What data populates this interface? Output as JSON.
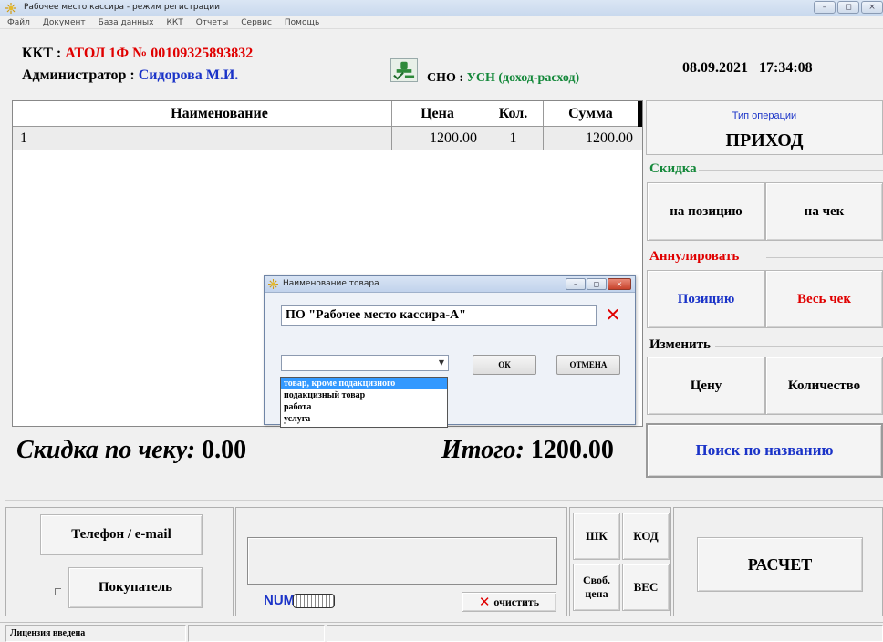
{
  "window": {
    "title": "Рабочее место кассира - режим регистрации",
    "controls": [
      "–",
      "◻",
      "×"
    ]
  },
  "menu": [
    "Файл",
    "Документ",
    "База данных",
    "ККТ",
    "Отчеты",
    "Сервис",
    "Помощь"
  ],
  "header": {
    "kkt_label": "ККТ : ",
    "kkt_value": "АТОЛ 1Ф № 00109325893832",
    "admin_label": "Администратор : ",
    "admin_value": "Сидорова М.И.",
    "sno_label": "СНО : ",
    "sno_value": "УСН (доход-расход)",
    "date": "08.09.2021",
    "time": "17:34:08"
  },
  "table": {
    "columns": [
      "",
      "Наименование",
      "Цена",
      "Кол.",
      "Сумма"
    ],
    "rows": [
      {
        "num": "1",
        "name": "",
        "price": "1200.00",
        "qty": "1",
        "sum": "1200.00"
      }
    ]
  },
  "operation": {
    "caption": "Тип операции",
    "value": "ПРИХОД"
  },
  "discount": {
    "label": "Скидка",
    "per_item": "на позицию",
    "per_check": "на чек"
  },
  "cancel": {
    "label": "Аннулировать",
    "item": "Позицию",
    "whole_check": "Весь чек"
  },
  "change": {
    "label": "Изменить",
    "price": "Цену",
    "quantity": "Количество"
  },
  "search_by_name": "Поиск по названию",
  "totals": {
    "discount_label": "Скидка по чеку:",
    "discount_value": "0.00",
    "total_label": "Итого:",
    "total_value": "1200.00"
  },
  "bottom": {
    "phone_email": "Телефон / e-mail",
    "buyer": "Покупатель",
    "num_indicator": "NUM",
    "clear": "очистить",
    "barcode": "ШК",
    "code": "КОД",
    "free_price": "Своб. цена",
    "weight": "ВЕС",
    "payment": "РАСЧЕТ"
  },
  "status": {
    "license": "Лицензия введена"
  },
  "dialog": {
    "title": "Наименование товара",
    "name_value": "ПО \"Рабочее место кассира-А\"",
    "ok": "ОК",
    "cancel": "ОТМЕНА",
    "select_value": "",
    "options": [
      "товар, кроме подакцизного",
      "подакцизный товар",
      "работа",
      "услуга"
    ],
    "selected_index": 0
  },
  "colors": {
    "red": "#e00000",
    "blue": "#1a33c8",
    "green": "#14883a",
    "selection": "#3399ff"
  }
}
